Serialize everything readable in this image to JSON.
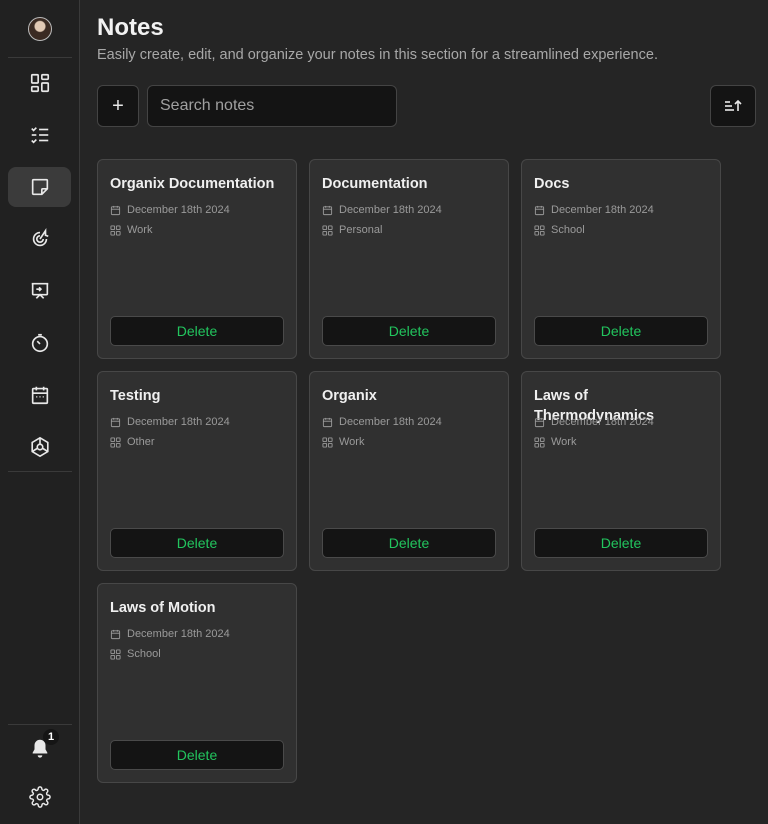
{
  "page": {
    "title": "Notes",
    "subtitle": "Easily create, edit, and organize your notes in this section for a streamlined experience."
  },
  "toolbar": {
    "add_label": "+",
    "search_placeholder": "Search notes",
    "search_value": ""
  },
  "sidebar": {
    "items": [
      {
        "icon": "dashboard-icon",
        "active": false
      },
      {
        "icon": "checklist-icon",
        "active": false
      },
      {
        "icon": "sticky-note-icon",
        "active": true
      },
      {
        "icon": "focus-target-icon",
        "active": false
      },
      {
        "icon": "presentation-icon",
        "active": false
      },
      {
        "icon": "timer-icon",
        "active": false
      },
      {
        "icon": "calendar-icon",
        "active": false
      },
      {
        "icon": "integration-icon",
        "active": false
      }
    ],
    "notifications_count": "1"
  },
  "notes": [
    {
      "title": "Organix Documentation",
      "date": "December 18th 2024",
      "category": "Work",
      "delete_label": "Delete"
    },
    {
      "title": "Documentation",
      "date": "December 18th 2024",
      "category": "Personal",
      "delete_label": "Delete"
    },
    {
      "title": "Docs",
      "date": "December 18th 2024",
      "category": "School",
      "delete_label": "Delete"
    },
    {
      "title": "Testing",
      "date": "December 18th 2024",
      "category": "Other",
      "delete_label": "Delete"
    },
    {
      "title": "Organix",
      "date": "December 18th 2024",
      "category": "Work",
      "delete_label": "Delete"
    },
    {
      "title": "Laws of Thermodynamics",
      "date": "December 18th 2024",
      "category": "Work",
      "delete_label": "Delete"
    },
    {
      "title": "Laws of Motion",
      "date": "December 18th 2024",
      "category": "School",
      "delete_label": "Delete"
    }
  ],
  "colors": {
    "background": "#252525",
    "card": "#303030",
    "accent_delete": "#22c55e"
  }
}
